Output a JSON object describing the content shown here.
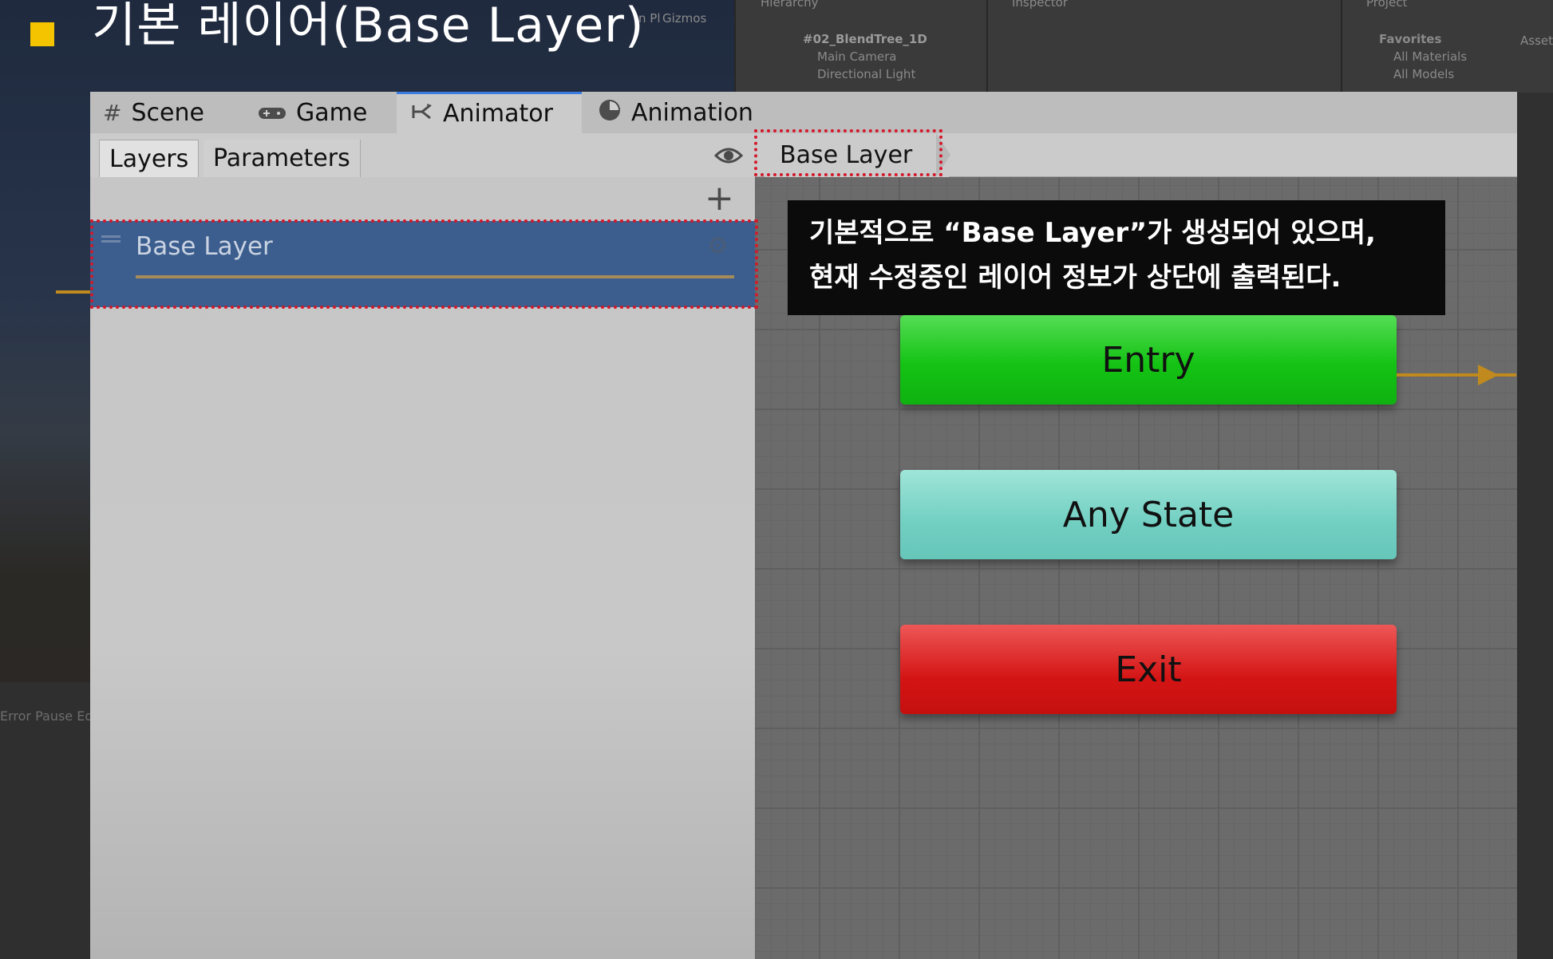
{
  "slide": {
    "title": "기본 레이어(Base Layer)",
    "bullet_color": "#f5c400"
  },
  "background_editor": {
    "scene_controls": [
      "n Pl",
      "Gizmos"
    ],
    "hierarchy_tab": "Hierarchy",
    "hierarchy_items": [
      "#02_BlendTree_1D",
      "Main Camera",
      "Directional Light"
    ],
    "inspector_tab": "Inspector",
    "project_tab": "Project",
    "project_items": [
      "Favorites",
      "All Materials",
      "All Models"
    ],
    "assets_label": "Asset",
    "status_text": "Error Pause  Edi"
  },
  "window": {
    "tabs": [
      {
        "label": "Scene",
        "icon": "grid-icon"
      },
      {
        "label": "Game",
        "icon": "gamepad-icon"
      },
      {
        "label": "Animator",
        "icon": "animator-icon"
      },
      {
        "label": "Animation",
        "icon": "clock-icon"
      }
    ],
    "active_tab": "Animator",
    "subtabs": [
      "Layers",
      "Parameters"
    ],
    "active_subtab": "Layers",
    "add_symbol": "+",
    "breadcrumb": "Base Layer",
    "layers": [
      {
        "name": "Base Layer",
        "selected": true
      }
    ]
  },
  "graph": {
    "states": [
      {
        "label": "Entry",
        "color": "#14c314"
      },
      {
        "label": "Any State",
        "color": "#71cfc2"
      },
      {
        "label": "Exit",
        "color": "#d41414"
      }
    ],
    "transition_color": "#c08a1e"
  },
  "callout": {
    "line1": "기본적으로 “Base Layer”가 생성되어 있으며,",
    "line2": "현재 수정중인 레이어 정보가 상단에 출력된다."
  },
  "highlight_color": "#d4182a"
}
